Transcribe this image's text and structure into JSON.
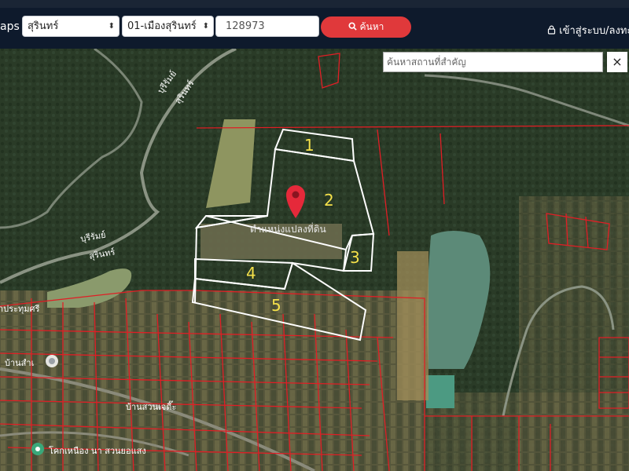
{
  "header": {
    "brand_partial": "aps",
    "province_select": "สุรินทร์",
    "district_select": "01-เมืองสุรินทร์",
    "deed_input": "128973",
    "search_button": "ค้นหา",
    "login_link": "เข้าสู่ระบบ/ลงทะ"
  },
  "map": {
    "place_search_placeholder": "ค้นหาสถานที่สำคัญ",
    "close_label": "×",
    "plot_labels": [
      "1",
      "2",
      "3",
      "4",
      "5"
    ],
    "parcel_caption": "ตำแหน่งแปลงที่ดิน",
    "road_labels": [
      "บุรีรัมย์",
      "สุรินทร์",
      "บุรีรัมย์",
      "สุรินทร์"
    ],
    "village_labels": [
      "บ้านสำเ",
      "บ้านสวนเจดี๊ะ",
      "โคกเหนือง นา สวนยอแสง",
      "าประทุมศรี"
    ],
    "colors": {
      "boundary": "#ffffff",
      "cadastral": "#e01e25",
      "pin": "#e5293a",
      "plot_number": "#f4e04a"
    }
  }
}
